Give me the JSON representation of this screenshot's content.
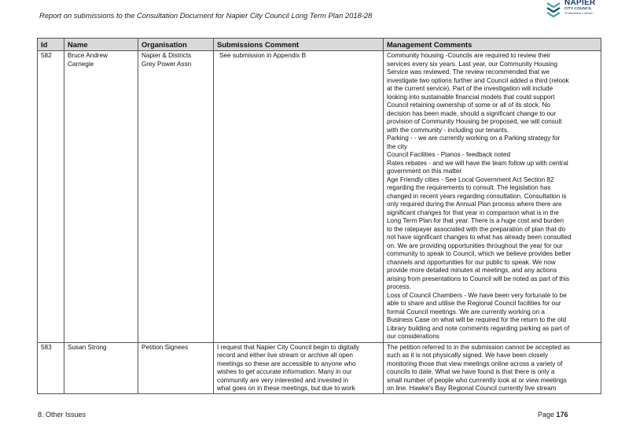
{
  "header": {
    "title": "Report on submissions to the Consultation Document for Napier City Council Long Term Plan 2018-28",
    "logo": {
      "brand": "NAPIER",
      "sub1": "CITY COUNCIL",
      "sub2": "Te Kaunihera o Ahuriri",
      "icon": "napier-wave-icon",
      "color": "#1a3a6b",
      "wave_color": "#26a8a0"
    }
  },
  "table": {
    "headers": [
      "Id",
      "Name",
      "Organisation",
      "Submissions Comment",
      "Management Comments"
    ],
    "rows": [
      {
        "id": "582",
        "name": [
          "Bruce Andrew",
          "Carnegie"
        ],
        "org": [
          "Napier & Districts",
          "Grey Power Assn"
        ],
        "submission": [
          "See submission in Appendix B"
        ],
        "management": [
          "Community housing  -Councils are required to review their",
          "services every six years.  Last year, our Community Housing",
          "Service was reviewed.  The review recommended that we",
          "investigate two options further and Council added a third (relook",
          "at the current service).  Part of the investigation will include",
          "looking into sustainable financial models that could support",
          "Council retaining ownership of some or all of its stock.  No",
          "decision has been made, should a significant change to our",
          "provision of Community Housing be proposed, we will consult",
          "with the community - including our tenants.",
          "Parking -  - we are currently working on a Parking strategy for",
          "the city",
          "Council Facilities - Pianos - feedback noted",
          "Rates rebates -  and we will have the team follow up with central",
          "government on this matter",
          "Age Friendly cities - See Local Government Act Section 82",
          "regarding the requirements to consult.  The legislation has",
          "changed in recent years regarding consultation. Consultation is",
          "only required during the Annual Plan process where there are",
          "significant changes for that year in comparison what is in the",
          "Long Term Plan for that year.  There is a huge cost and burden",
          "to the ratepayer associated with the preparation of plan that do",
          "not have significant changes to what has already been consulted",
          "on. We are providing opportunities throughout the year for our",
          "community to speak to Council, which we believe provides better",
          "channels and opportunities for our public to speak.  We now",
          "provide more detailed minutes at meetings, and any actions",
          "arising from presentations to Council will be noted as part of this",
          "process.",
          "Loss of Council Chambers - We have been very fortunate to be",
          "able to share and utilise the Regional Council facilities for our",
          "formal Council meetings.  We are currently working on a",
          "Business Case on what will be required for the return to the old",
          "Library building and note comments regarding parking as part of",
          "our considerations"
        ]
      },
      {
        "id": "583",
        "name": [
          "Susan Strong"
        ],
        "org": [
          "Petition Signees"
        ],
        "submission": [
          "I request that Napier City Council begin to digitally",
          "record and either live stream or archive all open",
          "meetings so these are accessible to anyone who",
          "wishes to get accurate information. Many in our",
          "community are very interested and invested in",
          "what goes on in these meetings, but due to work"
        ],
        "management": [
          "The petition referred to in the submission cannot be accepted as",
          "such as it is not physically signed.  We have been closely",
          "monitoring those that view meetings online across a variety of",
          "councils to date.  What we have found is that there is only a",
          "small number of people who currrently look at or view meetings",
          "on line.  Hawke's Bay Regional Council currently live stream"
        ]
      }
    ]
  },
  "footer": {
    "section": "8. Other Issues",
    "page_label": "Page",
    "page_number": "176"
  }
}
